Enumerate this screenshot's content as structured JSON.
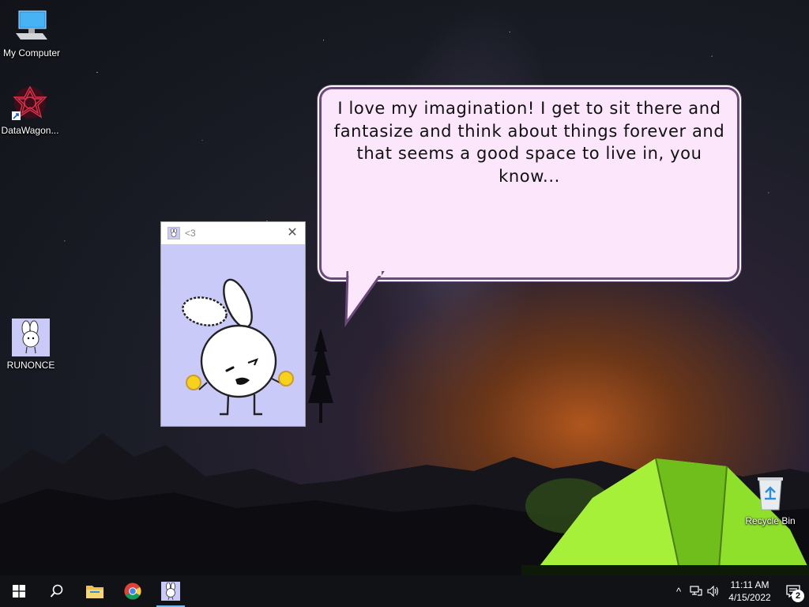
{
  "desktop": {
    "icons": [
      {
        "label": "My Computer",
        "icon": "computer-icon"
      },
      {
        "label": "DataWagon...",
        "icon": "datawagon-icon"
      },
      {
        "label": "RUNONCE",
        "icon": "bunny-icon"
      },
      {
        "label": "Recycle Bin",
        "icon": "recycle-bin-icon"
      }
    ]
  },
  "speech_bubble": {
    "text": "I love my imagination! I get to sit there and fantasize and think about things forever and that seems a good space to live in, you know..."
  },
  "app_window": {
    "title": "<3",
    "close_label": "✕",
    "background": "#c9caf7"
  },
  "taskbar": {
    "items": [
      "start-icon",
      "search-icon",
      "file-explorer-icon",
      "chrome-icon",
      "bunny-app-icon"
    ],
    "tray": {
      "chevron": "^",
      "time": "11:11 AM",
      "date": "4/15/2022",
      "notification_count": "2"
    }
  },
  "colors": {
    "accent": "#76b9ed",
    "bubble_fill": "#fbe6fb",
    "bubble_border": "#6a4a7a",
    "tent": "#8fe02a"
  }
}
